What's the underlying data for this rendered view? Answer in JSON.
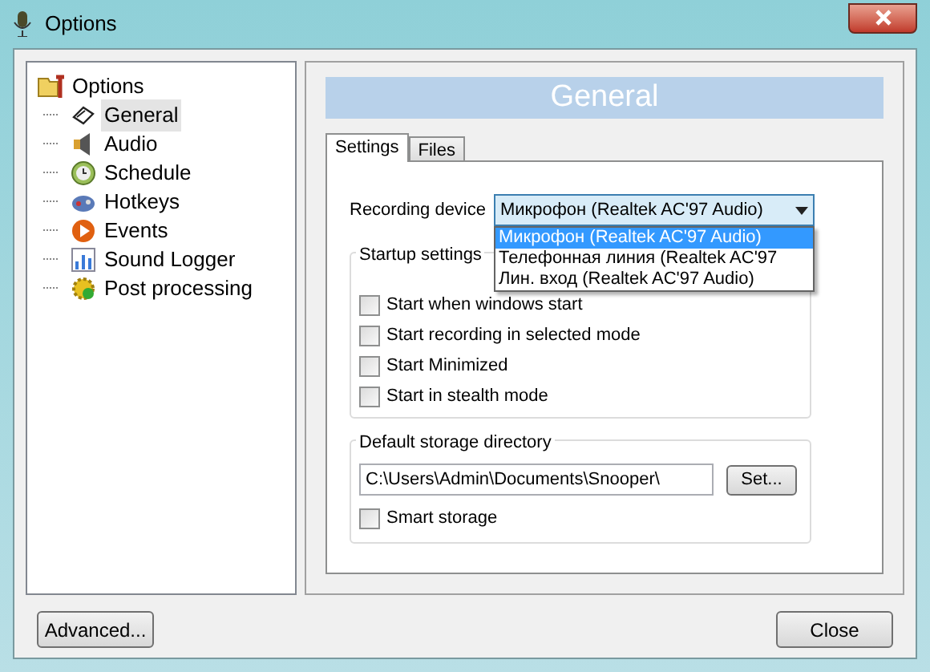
{
  "window": {
    "title": "Options"
  },
  "tree": {
    "label": "Options",
    "children": [
      {
        "label": "General",
        "selected": true
      },
      {
        "label": "Audio",
        "selected": false
      },
      {
        "label": "Schedule",
        "selected": false
      },
      {
        "label": "Hotkeys",
        "selected": false
      },
      {
        "label": "Events",
        "selected": false
      },
      {
        "label": "Sound Logger",
        "selected": false
      },
      {
        "label": "Post processing",
        "selected": false
      }
    ]
  },
  "header": "General",
  "tabs": [
    {
      "label": "Settings",
      "selected": true
    },
    {
      "label": "Files",
      "selected": false
    }
  ],
  "recording_device": {
    "label": "Recording device",
    "value": "Микрофон (Realtek AC'97 Audio)",
    "expanded": true,
    "options": [
      {
        "label": "Микрофон (Realtek AC'97 Audio)",
        "selected": true
      },
      {
        "label": "Телефонная линия (Realtek AC'97",
        "selected": false
      },
      {
        "label": "Лин. вход (Realtek AC'97 Audio)",
        "selected": false
      }
    ]
  },
  "startup_settings": {
    "title": "Startup settings",
    "options": [
      {
        "label": "Start when windows start",
        "checked": false
      },
      {
        "label": "Start recording in selected mode",
        "checked": false
      },
      {
        "label": "Start Minimized",
        "checked": false
      },
      {
        "label": "Start in stealth mode",
        "checked": false
      }
    ]
  },
  "storage": {
    "title": "Default storage directory",
    "path": "C:\\Users\\Admin\\Documents\\Snooper\\",
    "set_button": "Set...",
    "smart_storage": {
      "label": "Smart storage",
      "checked": false
    }
  },
  "buttons": {
    "advanced": "Advanced...",
    "close": "Close"
  }
}
